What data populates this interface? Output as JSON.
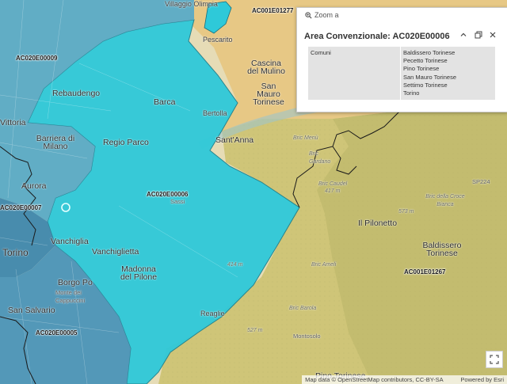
{
  "map": {
    "areas": [
      {
        "code": "AC020E00006",
        "fill": "#2ec9d9"
      },
      {
        "code": "AC020E00009",
        "fill": "#5fa9c4"
      },
      {
        "code": "AC020E00007",
        "fill": "#4a8fb3"
      },
      {
        "code": "AC020E00005",
        "fill": "#4a8fb3"
      },
      {
        "code": "AC001E01277",
        "fill": "#e0c277"
      },
      {
        "code": "AC001E01267",
        "fill": "#c9c276"
      }
    ],
    "area_labels": {
      "a1277": "AC001E01277",
      "a09": "AC020E00009",
      "a06": "AC020E00006",
      "a07": "AC020E00007",
      "a1267": "AC001E01267",
      "a05": "AC020E00005"
    },
    "places": {
      "villaggio": "Villaggio Olimpia",
      "pescarito": "Pescarito",
      "cascina": "Cascina del Mulino",
      "sanmauro": "San Mauro Torinese",
      "rebaudengo": "Rebaudengo",
      "barca": "Barca",
      "bertolla": "Bertolla",
      "vittoria": "Vittoria",
      "barriera": "Barriera di Milano",
      "regioparco": "Regio Parco",
      "santanna": "Sant'Anna",
      "aurora": "Aurora",
      "vanchiglia": "Vanchiglia",
      "vanchiglietta": "Vanchiglietta",
      "madonna": "Madonna del Pilone",
      "reaglie": "Reaglie",
      "torino": "Torino",
      "borgopo": "Borgo Po",
      "sansalvario": "San Salvario",
      "pilonetto": "Il Pilonetto",
      "baldissero": "Baldissero Torinese",
      "pino": "Pino Torinese",
      "sp224": "SP224",
      "sassi": "Sassi",
      "monte": "Monte dei Cappuccini",
      "montosolo": "Montosolo",
      "bric_menu": "Bric Menù",
      "bric_gardano": "Bric Gardano",
      "bric_caudel": "Bric Caudel",
      "croce_bianca": "Bric della Croce Bianca",
      "bric_barola": "Bric Barola",
      "bric_ameli": "Bric Ameli",
      "m417": "417 m",
      "m573": "573 m",
      "m527": "527 m",
      "m414": "414 m"
    }
  },
  "popup": {
    "zoom_label": "Zoom a",
    "title": "Area Convenzionale: AC020E00006",
    "field_label": "Comuni",
    "comuni": [
      "Baldissero Torinese",
      "Pecetto Torinese",
      "Pino Torinese",
      "San Mauro Torinese",
      "Settimo Torinese",
      "Torino"
    ]
  },
  "attribution": {
    "data": "Map data © OpenStreetMap contributors, CC-BY-SA",
    "powered": "Powered by Esri"
  }
}
